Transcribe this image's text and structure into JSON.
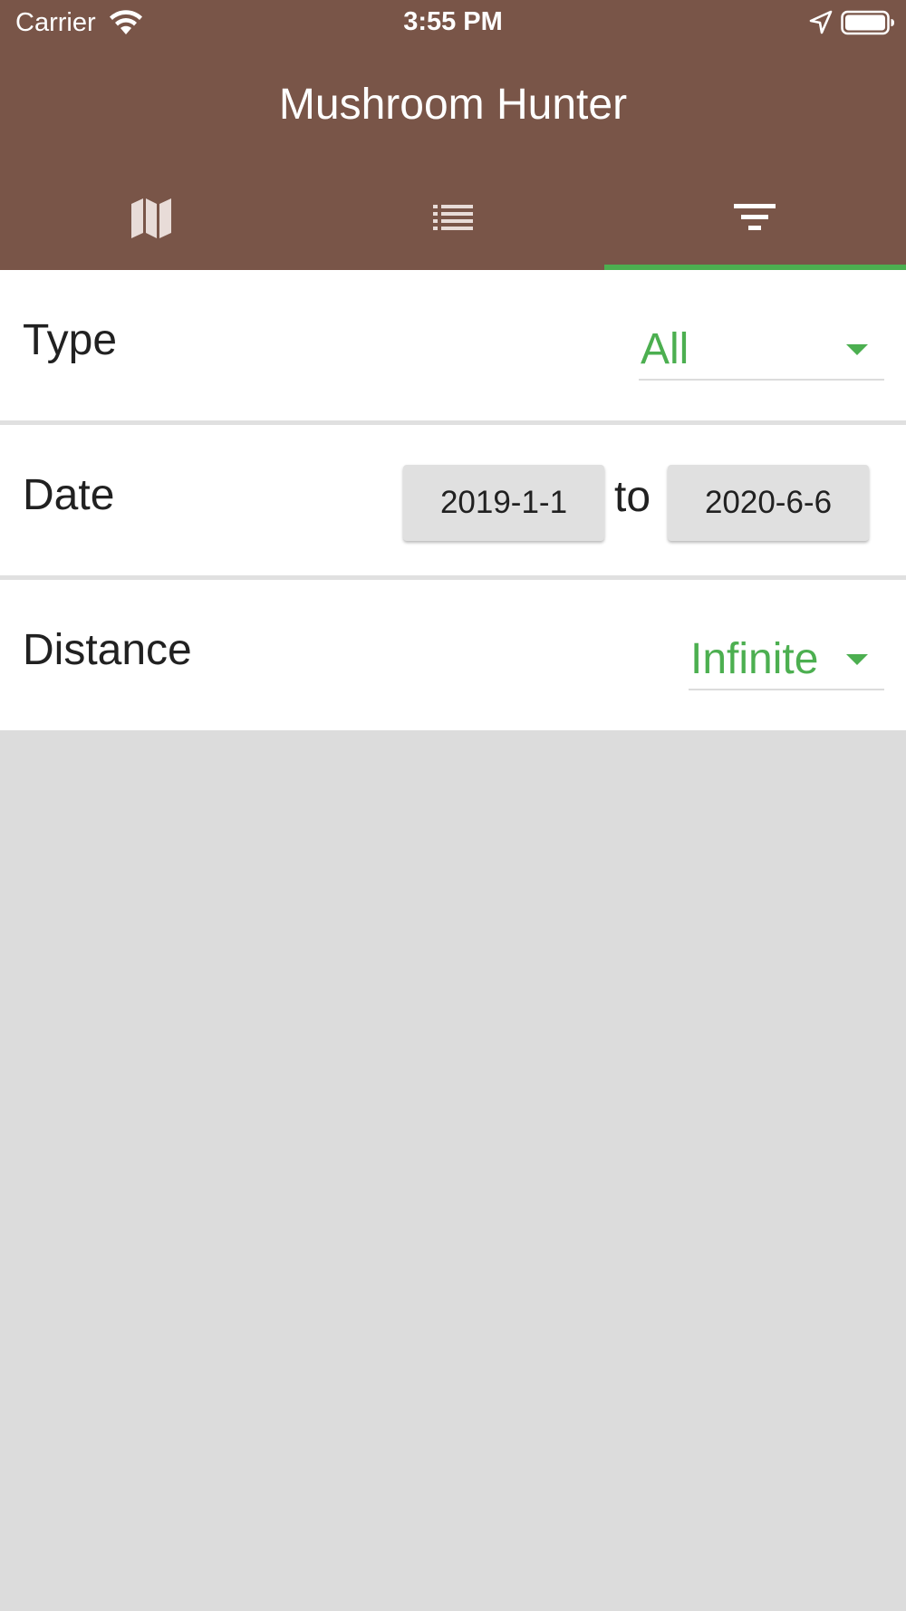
{
  "status_bar": {
    "carrier": "Carrier",
    "time": "3:55 PM",
    "icons": [
      "wifi-icon",
      "location-arrow-icon",
      "battery-icon"
    ]
  },
  "app": {
    "title": "Mushroom Hunter",
    "tabs": [
      {
        "icon": "map-icon",
        "selected": false
      },
      {
        "icon": "list-icon",
        "selected": false
      },
      {
        "icon": "filter-icon",
        "selected": true
      }
    ]
  },
  "filters": {
    "type": {
      "label": "Type",
      "value": "All"
    },
    "date": {
      "label": "Date",
      "from": "2019-1-1",
      "separator": "to",
      "to": "2020-6-6"
    },
    "distance": {
      "label": "Distance",
      "value": "Infinite"
    }
  },
  "colors": {
    "primary": "#795548",
    "accent": "#4caf50",
    "background": "#dcdcdc",
    "button": "#e0e0e0"
  }
}
